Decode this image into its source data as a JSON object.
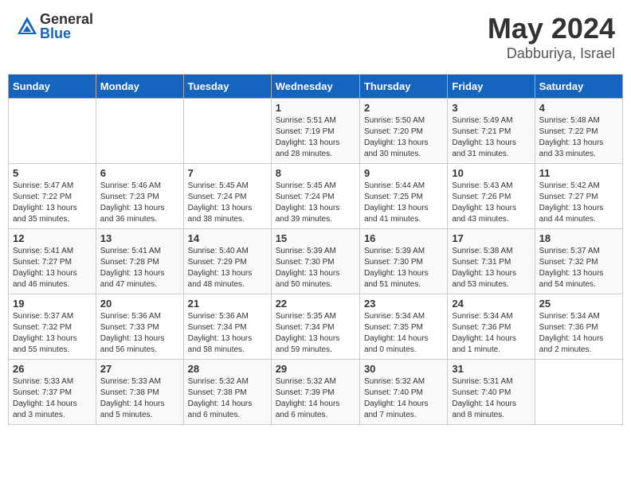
{
  "logo": {
    "general": "General",
    "blue": "Blue"
  },
  "title": {
    "month": "May 2024",
    "location": "Dabburiya, Israel"
  },
  "weekdays": [
    "Sunday",
    "Monday",
    "Tuesday",
    "Wednesday",
    "Thursday",
    "Friday",
    "Saturday"
  ],
  "weeks": [
    [
      {
        "day": "",
        "info": ""
      },
      {
        "day": "",
        "info": ""
      },
      {
        "day": "",
        "info": ""
      },
      {
        "day": "1",
        "info": "Sunrise: 5:51 AM\nSunset: 7:19 PM\nDaylight: 13 hours\nand 28 minutes."
      },
      {
        "day": "2",
        "info": "Sunrise: 5:50 AM\nSunset: 7:20 PM\nDaylight: 13 hours\nand 30 minutes."
      },
      {
        "day": "3",
        "info": "Sunrise: 5:49 AM\nSunset: 7:21 PM\nDaylight: 13 hours\nand 31 minutes."
      },
      {
        "day": "4",
        "info": "Sunrise: 5:48 AM\nSunset: 7:22 PM\nDaylight: 13 hours\nand 33 minutes."
      }
    ],
    [
      {
        "day": "5",
        "info": "Sunrise: 5:47 AM\nSunset: 7:22 PM\nDaylight: 13 hours\nand 35 minutes."
      },
      {
        "day": "6",
        "info": "Sunrise: 5:46 AM\nSunset: 7:23 PM\nDaylight: 13 hours\nand 36 minutes."
      },
      {
        "day": "7",
        "info": "Sunrise: 5:45 AM\nSunset: 7:24 PM\nDaylight: 13 hours\nand 38 minutes."
      },
      {
        "day": "8",
        "info": "Sunrise: 5:45 AM\nSunset: 7:24 PM\nDaylight: 13 hours\nand 39 minutes."
      },
      {
        "day": "9",
        "info": "Sunrise: 5:44 AM\nSunset: 7:25 PM\nDaylight: 13 hours\nand 41 minutes."
      },
      {
        "day": "10",
        "info": "Sunrise: 5:43 AM\nSunset: 7:26 PM\nDaylight: 13 hours\nand 43 minutes."
      },
      {
        "day": "11",
        "info": "Sunrise: 5:42 AM\nSunset: 7:27 PM\nDaylight: 13 hours\nand 44 minutes."
      }
    ],
    [
      {
        "day": "12",
        "info": "Sunrise: 5:41 AM\nSunset: 7:27 PM\nDaylight: 13 hours\nand 46 minutes."
      },
      {
        "day": "13",
        "info": "Sunrise: 5:41 AM\nSunset: 7:28 PM\nDaylight: 13 hours\nand 47 minutes."
      },
      {
        "day": "14",
        "info": "Sunrise: 5:40 AM\nSunset: 7:29 PM\nDaylight: 13 hours\nand 48 minutes."
      },
      {
        "day": "15",
        "info": "Sunrise: 5:39 AM\nSunset: 7:30 PM\nDaylight: 13 hours\nand 50 minutes."
      },
      {
        "day": "16",
        "info": "Sunrise: 5:39 AM\nSunset: 7:30 PM\nDaylight: 13 hours\nand 51 minutes."
      },
      {
        "day": "17",
        "info": "Sunrise: 5:38 AM\nSunset: 7:31 PM\nDaylight: 13 hours\nand 53 minutes."
      },
      {
        "day": "18",
        "info": "Sunrise: 5:37 AM\nSunset: 7:32 PM\nDaylight: 13 hours\nand 54 minutes."
      }
    ],
    [
      {
        "day": "19",
        "info": "Sunrise: 5:37 AM\nSunset: 7:32 PM\nDaylight: 13 hours\nand 55 minutes."
      },
      {
        "day": "20",
        "info": "Sunrise: 5:36 AM\nSunset: 7:33 PM\nDaylight: 13 hours\nand 56 minutes."
      },
      {
        "day": "21",
        "info": "Sunrise: 5:36 AM\nSunset: 7:34 PM\nDaylight: 13 hours\nand 58 minutes."
      },
      {
        "day": "22",
        "info": "Sunrise: 5:35 AM\nSunset: 7:34 PM\nDaylight: 13 hours\nand 59 minutes."
      },
      {
        "day": "23",
        "info": "Sunrise: 5:34 AM\nSunset: 7:35 PM\nDaylight: 14 hours\nand 0 minutes."
      },
      {
        "day": "24",
        "info": "Sunrise: 5:34 AM\nSunset: 7:36 PM\nDaylight: 14 hours\nand 1 minute."
      },
      {
        "day": "25",
        "info": "Sunrise: 5:34 AM\nSunset: 7:36 PM\nDaylight: 14 hours\nand 2 minutes."
      }
    ],
    [
      {
        "day": "26",
        "info": "Sunrise: 5:33 AM\nSunset: 7:37 PM\nDaylight: 14 hours\nand 3 minutes."
      },
      {
        "day": "27",
        "info": "Sunrise: 5:33 AM\nSunset: 7:38 PM\nDaylight: 14 hours\nand 5 minutes."
      },
      {
        "day": "28",
        "info": "Sunrise: 5:32 AM\nSunset: 7:38 PM\nDaylight: 14 hours\nand 6 minutes."
      },
      {
        "day": "29",
        "info": "Sunrise: 5:32 AM\nSunset: 7:39 PM\nDaylight: 14 hours\nand 6 minutes."
      },
      {
        "day": "30",
        "info": "Sunrise: 5:32 AM\nSunset: 7:40 PM\nDaylight: 14 hours\nand 7 minutes."
      },
      {
        "day": "31",
        "info": "Sunrise: 5:31 AM\nSunset: 7:40 PM\nDaylight: 14 hours\nand 8 minutes."
      },
      {
        "day": "",
        "info": ""
      }
    ]
  ]
}
